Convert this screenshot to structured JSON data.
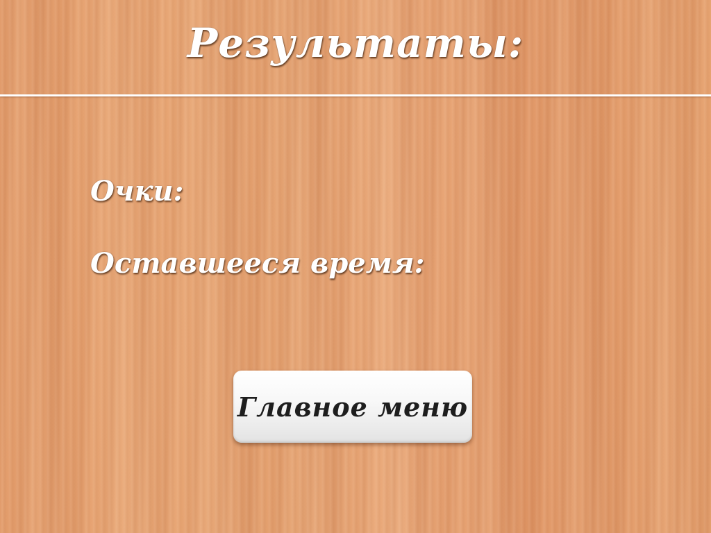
{
  "screen": {
    "title": "Результаты:",
    "score_label": "Очки:",
    "time_left_label": "Оставшееся время:",
    "main_menu_button": "Главное меню"
  },
  "colors": {
    "background": "#e4a06e",
    "text": "#ffffff",
    "button_bg": "#f7f7f7",
    "button_text": "#1e1e1e"
  }
}
